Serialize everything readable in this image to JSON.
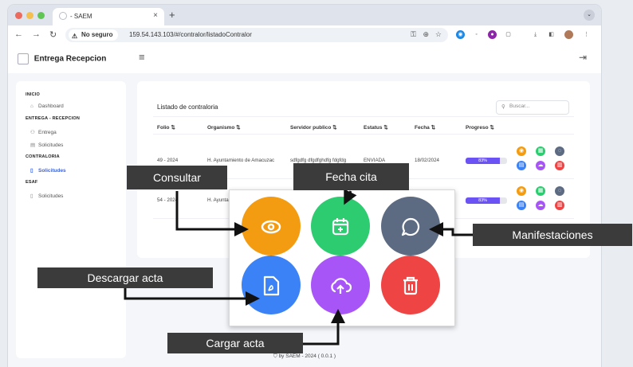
{
  "browser": {
    "tab_title": "- SAEM",
    "security": "No seguro",
    "url": "159.54.143.103/#/contralor/listadoContralor"
  },
  "app": {
    "name": "Entrega Recepcion"
  },
  "sidebar": {
    "sections": [
      {
        "title": "INICIO",
        "items": [
          {
            "label": "Dashboard",
            "icon": "home-icon"
          }
        ]
      },
      {
        "title": "ENTREGA - RECEPCION",
        "items": [
          {
            "label": "Entrega",
            "icon": "users-icon"
          },
          {
            "label": "Solicitudes",
            "icon": "document-icon"
          }
        ]
      },
      {
        "title": "CONTRALORIA",
        "items": [
          {
            "label": "Solicitudes",
            "icon": "document-icon",
            "active": true
          }
        ]
      },
      {
        "title": "ESAF",
        "items": [
          {
            "label": "Solicitudes",
            "icon": "document-icon"
          }
        ]
      }
    ]
  },
  "list": {
    "title": "Listado de contraloria",
    "search_placeholder": "Buscar...",
    "columns": [
      "Folio",
      "Organismo",
      "Servidor publico",
      "Estatus",
      "Fecha",
      "Progreso"
    ],
    "rows": [
      {
        "folio": "49 - 2024",
        "organismo": "H. Ayuntamiento de Amacuzac",
        "servidor": "sdfgdfg dfgdfghdfg fdgfdg",
        "estatus": "ENVIADA",
        "fecha": "18/02/2024",
        "progreso": "83%",
        "progreso_value": 83
      },
      {
        "folio": "54 - 2024",
        "organismo": "H. Ayunta",
        "servidor": "",
        "estatus": "",
        "fecha": "",
        "progreso": "83%",
        "progreso_value": 83
      }
    ]
  },
  "footer": {
    "text": "by SAEM - 2024 ( 0.0.1 )"
  },
  "callouts": {
    "consultar": "Consultar",
    "fecha_cita": "Fecha cita",
    "manifestaciones": "Manifestaciones",
    "descargar_acta": "Descargar acta",
    "cargar_acta": "Cargar acta"
  },
  "colors": {
    "orange": "#f39c12",
    "green": "#2ecc71",
    "slate": "#5d6b82",
    "blue": "#3b82f6",
    "purple": "#a855f7",
    "red": "#ef4444",
    "accent": "#3b63e0"
  }
}
